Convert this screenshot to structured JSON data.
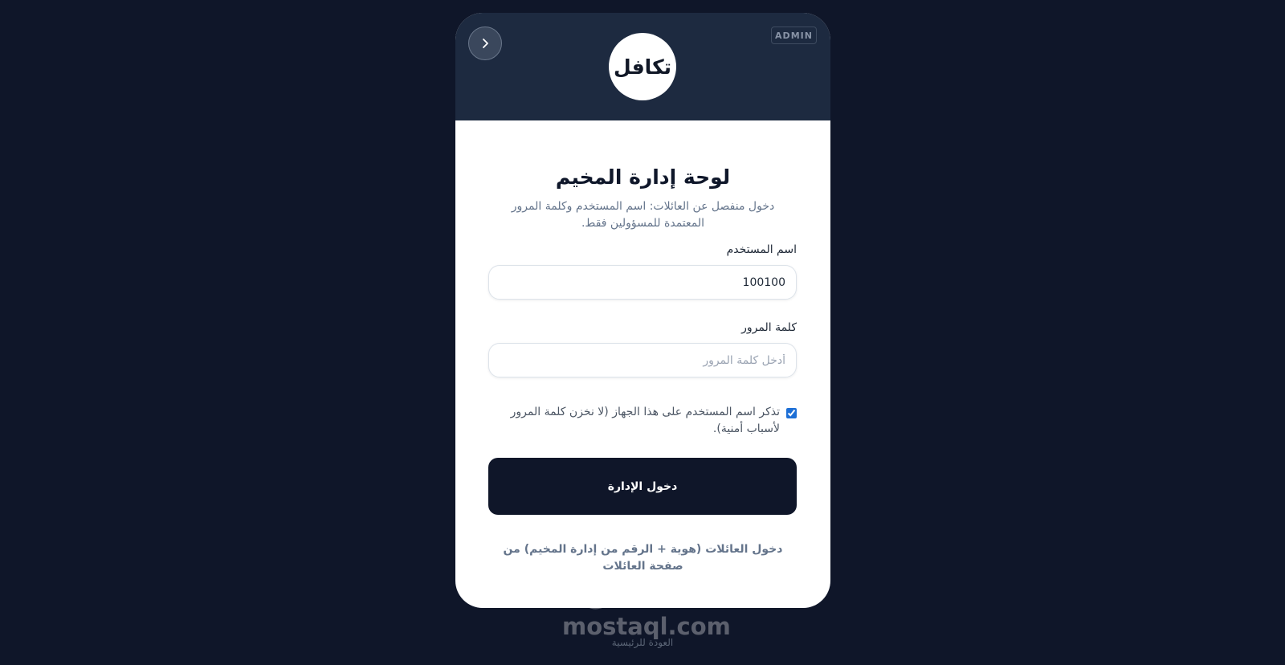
{
  "header": {
    "badge": "ADMIN",
    "logo_text": "تكافل"
  },
  "form": {
    "title": "لوحة إدارة المخيم",
    "subtitle": "دخول منفصل عن العائلات: اسم المستخدم وكلمة المرور المعتمدة للمسؤولين فقط.",
    "username_label": "اسم المستخدم",
    "username_value": "100100",
    "password_label": "كلمة المرور",
    "password_placeholder": "أدخل كلمة المرور",
    "remember_text": "تذكر اسم المستخدم على هذا الجهاز (لا نخزن كلمة المرور لأسباب أمنية).",
    "remember_checked": true,
    "submit_label": "دخول الإدارة",
    "family_link": "دخول العائلات (هوية + الرقم من إدارة المخيم) من صفحة العائلات"
  },
  "footer": {
    "home_link": "العودة للرئيسية"
  },
  "watermark": {
    "arabic": "مستقل",
    "latin": "mostaql.com"
  },
  "colors": {
    "page_background": "#0f1629",
    "header_background": "#1d2a40",
    "button_background": "#0f1629",
    "checkbox_accent": "#1d6fd6"
  },
  "icons": {
    "back": "chevron-right-icon"
  }
}
